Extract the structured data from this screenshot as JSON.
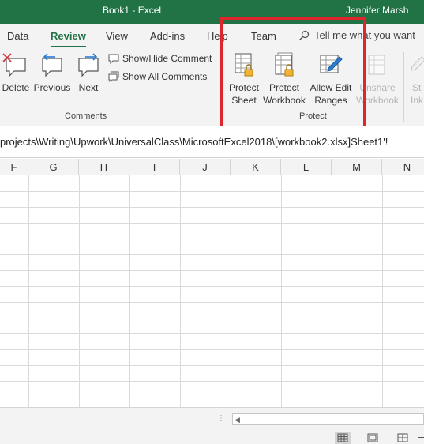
{
  "titlebar": {
    "title": "Book1  -  Excel",
    "user": "Jennifer Marsh"
  },
  "tabs": [
    "Data",
    "Review",
    "View",
    "Add-ins",
    "Help",
    "Team"
  ],
  "tell_me": "Tell me what you want",
  "ribbon": {
    "comments": {
      "delete": "Delete",
      "previous": "Previous",
      "next": "Next",
      "show_hide": "Show/Hide Comment",
      "show_all": "Show All Comments",
      "group": "Comments"
    },
    "protect": {
      "protect_sheet": [
        "Protect",
        "Sheet"
      ],
      "protect_workbook": [
        "Protect",
        "Workbook"
      ],
      "allow_edit": [
        "Allow Edit",
        "Ranges"
      ],
      "unshare": [
        "Unshare",
        "Workbook"
      ],
      "group": "Protect"
    },
    "ink": [
      "St",
      "Ink"
    ]
  },
  "formula_bar": {
    "reference": "projects\\Writing\\Upwork\\UniversalClass\\MicrosoftExcel2018\\[workbook2.xlsx]Sheet1'!"
  },
  "columns": [
    "F",
    "G",
    "H",
    "I",
    "J",
    "K",
    "L",
    "M",
    "N"
  ],
  "colors": {
    "accent": "#217346",
    "highlight": "#e0262d"
  }
}
